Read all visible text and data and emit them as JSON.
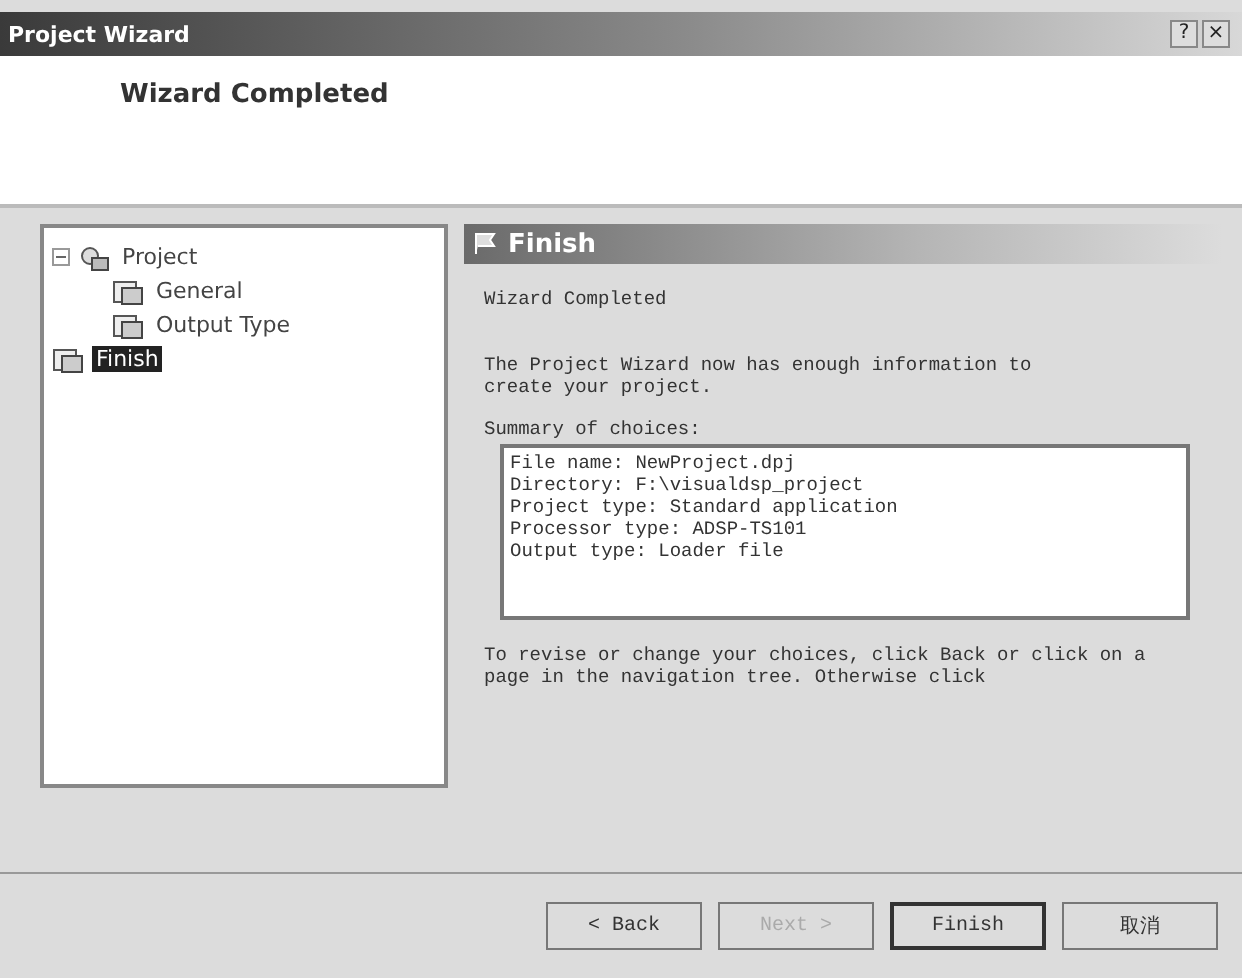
{
  "window": {
    "title": "Project Wizard",
    "help_button": "?",
    "close_button": "×"
  },
  "header": {
    "title": "Wizard Completed"
  },
  "tree": [
    {
      "label": "Project",
      "expanded": true,
      "selected": false,
      "children": [
        {
          "label": "General",
          "selected": false
        },
        {
          "label": "Output Type",
          "selected": false
        }
      ]
    },
    {
      "label": "Finish",
      "selected": true
    }
  ],
  "page": {
    "title": "Finish",
    "heading": "Wizard Completed",
    "intro": "The Project Wizard now has enough information to create your project.",
    "summary_label": "Summary of choices:",
    "summary_lines": [
      "File name: NewProject.dpj",
      "Directory: F:\\visualdsp_project",
      "Project type: Standard application",
      "Processor type: ADSP-TS101",
      "Output type: Loader file"
    ],
    "footer": "To revise or change your choices, click Back or click on a page in the navigation tree.  Otherwise click"
  },
  "buttons": [
    {
      "label": "< Back",
      "disabled": false,
      "default": false
    },
    {
      "label": "Next >",
      "disabled": true,
      "default": false
    },
    {
      "label": "Finish",
      "disabled": false,
      "default": true
    },
    {
      "label": "取消",
      "disabled": false,
      "default": false
    }
  ]
}
